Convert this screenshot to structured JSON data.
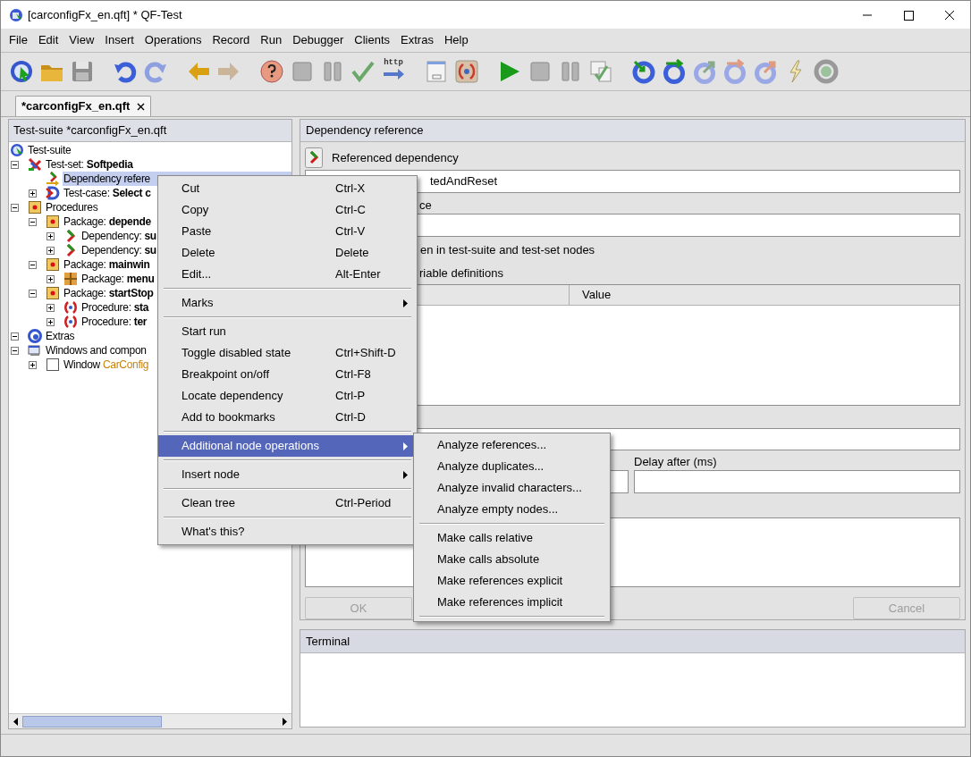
{
  "window": {
    "title": "[carconfigFx_en.qft] * QF-Test"
  },
  "menu_bar": [
    "File",
    "Edit",
    "View",
    "Insert",
    "Operations",
    "Record",
    "Run",
    "Debugger",
    "Clients",
    "Extras",
    "Help"
  ],
  "toolbar": [
    {
      "kind": "suite"
    },
    {
      "kind": "open"
    },
    {
      "kind": "save"
    },
    {
      "kind": "gap"
    },
    {
      "kind": "undo"
    },
    {
      "kind": "redo"
    },
    {
      "kind": "gap"
    },
    {
      "kind": "back"
    },
    {
      "kind": "forward"
    },
    {
      "kind": "gap"
    },
    {
      "kind": "help"
    },
    {
      "kind": "stop"
    },
    {
      "kind": "pause"
    },
    {
      "kind": "check"
    },
    {
      "kind": "http",
      "label": "http"
    },
    {
      "kind": "gap"
    },
    {
      "kind": "dialog"
    },
    {
      "kind": "procedure"
    },
    {
      "kind": "gap"
    },
    {
      "kind": "play"
    },
    {
      "kind": "stop"
    },
    {
      "kind": "pause"
    },
    {
      "kind": "checklist"
    },
    {
      "kind": "gap"
    },
    {
      "kind": "step_in"
    },
    {
      "kind": "step_over"
    },
    {
      "kind": "step_out"
    },
    {
      "kind": "skip_over"
    },
    {
      "kind": "skip_out"
    },
    {
      "kind": "lightning"
    },
    {
      "kind": "record"
    }
  ],
  "tabs": [
    {
      "label": "*carconfigFx_en.qft",
      "selected": true
    }
  ],
  "tree_panel": {
    "title": "Test-suite *carconfigFx_en.qft",
    "tree": [
      {
        "kind": "suite",
        "label": "Test-suite",
        "selected": false,
        "children": [
          {
            "kind": "testset",
            "label": "Test-set:",
            "name": "Softpedia",
            "selected": false,
            "expanded": true,
            "children": [
              {
                "kind": "depref",
                "label": "Dependency refere",
                "selected": true
              },
              {
                "kind": "testcase",
                "label": "Test-case:",
                "name": "Select c",
                "selected": false,
                "expanded": false
              }
            ]
          },
          {
            "kind": "procedures",
            "label": "Procedures",
            "selected": false,
            "expanded": true,
            "children": [
              {
                "kind": "package",
                "label": "Package:",
                "name": "depende",
                "selected": false,
                "expanded": true,
                "children": [
                  {
                    "kind": "dependency",
                    "label": "Dependency:",
                    "name": "su",
                    "selected": false,
                    "expanded": false
                  },
                  {
                    "kind": "dependency",
                    "label": "Dependency:",
                    "name": "su",
                    "selected": false,
                    "expanded": false
                  }
                ]
              },
              {
                "kind": "package",
                "label": "Package:",
                "name": "mainwin",
                "selected": false,
                "expanded": true,
                "children": [
                  {
                    "kind": "package_grid",
                    "label": "Package:",
                    "name": "menu",
                    "selected": false,
                    "expanded": false
                  }
                ]
              },
              {
                "kind": "package",
                "label": "Package:",
                "name": "startStop",
                "selected": false,
                "expanded": true,
                "children": [
                  {
                    "kind": "procedure",
                    "label": "Procedure:",
                    "name": "sta",
                    "selected": false,
                    "expanded": false
                  },
                  {
                    "kind": "procedure",
                    "label": "Procedure:",
                    "name": "ter",
                    "selected": false,
                    "expanded": false
                  }
                ]
              }
            ]
          },
          {
            "kind": "extras",
            "label": "Extras",
            "selected": false,
            "expanded": true
          },
          {
            "kind": "windows",
            "label": "Windows and compon",
            "selected": false,
            "expanded": true,
            "children": [
              {
                "kind": "window",
                "label": "Window",
                "name": "CarConfig",
                "selected": false,
                "expanded": false
              }
            ]
          }
        ]
      }
    ]
  },
  "editor": {
    "title": "Dependency reference",
    "referenced_dependency_label": "Referenced dependency",
    "referenced_dependency_value": "tedAndReset",
    "namespace_label": "ce",
    "checkbox_label": "en in test-suite and test-set nodes",
    "variables_label": "riable definitions",
    "table_columns": [
      "Value"
    ],
    "delay_after_label": "Delay after (ms)",
    "buttons": [
      {
        "label": "OK",
        "disabled": true
      },
      {
        "label": "Cancel",
        "disabled": true
      }
    ]
  },
  "terminal": {
    "title": "Terminal"
  },
  "context_menu": {
    "items": [
      {
        "kind": "item",
        "label": "Cut",
        "shortcut": "Ctrl-X",
        "selected": false
      },
      {
        "kind": "item",
        "label": "Copy",
        "shortcut": "Ctrl-C",
        "selected": false
      },
      {
        "kind": "item",
        "label": "Paste",
        "shortcut": "Ctrl-V",
        "selected": false
      },
      {
        "kind": "item",
        "label": "Delete",
        "shortcut": "Delete",
        "selected": false
      },
      {
        "kind": "item",
        "label": "Edit...",
        "shortcut": "Alt-Enter",
        "selected": false
      },
      {
        "kind": "separator"
      },
      {
        "kind": "item",
        "label": "Marks",
        "submenu": true,
        "selected": false
      },
      {
        "kind": "separator"
      },
      {
        "kind": "item",
        "label": "Start run",
        "selected": false
      },
      {
        "kind": "item",
        "label": "Toggle disabled state",
        "shortcut": "Ctrl+Shift-D",
        "selected": false
      },
      {
        "kind": "item",
        "label": "Breakpoint on/off",
        "shortcut": "Ctrl-F8",
        "selected": false
      },
      {
        "kind": "item",
        "label": "Locate dependency",
        "shortcut": "Ctrl-P",
        "selected": false
      },
      {
        "kind": "item",
        "label": "Add to bookmarks",
        "shortcut": "Ctrl-D",
        "selected": false
      },
      {
        "kind": "separator"
      },
      {
        "kind": "item",
        "label": "Additional node operations",
        "submenu": true,
        "selected": true
      },
      {
        "kind": "separator"
      },
      {
        "kind": "item",
        "label": "Insert node",
        "submenu": true,
        "selected": false
      },
      {
        "kind": "separator"
      },
      {
        "kind": "item",
        "label": "Clean tree",
        "shortcut": "Ctrl-Period",
        "selected": false
      },
      {
        "kind": "separator"
      },
      {
        "kind": "item",
        "label": "What's this?",
        "selected": false
      }
    ]
  },
  "submenu": {
    "items": [
      {
        "kind": "item",
        "label": "Analyze references...",
        "selected": false
      },
      {
        "kind": "item",
        "label": "Analyze duplicates...",
        "selected": false
      },
      {
        "kind": "item",
        "label": "Analyze invalid characters...",
        "selected": false
      },
      {
        "kind": "item",
        "label": "Analyze empty nodes...",
        "selected": false
      },
      {
        "kind": "separator"
      },
      {
        "kind": "item",
        "label": "Make calls relative",
        "selected": false
      },
      {
        "kind": "item",
        "label": "Make calls absolute",
        "selected": false
      },
      {
        "kind": "item",
        "label": "Make references explicit",
        "selected": false
      },
      {
        "kind": "item",
        "label": "Make references implicit",
        "selected": false
      },
      {
        "kind": "separator"
      }
    ]
  }
}
